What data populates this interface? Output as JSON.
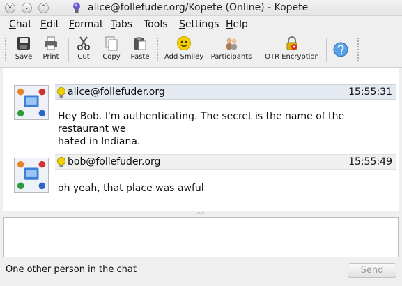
{
  "window": {
    "title": "alice@follefuder.org/Kopete (Online) - Kopete",
    "controls": [
      "close-icon",
      "minimize-icon",
      "maximize-icon"
    ]
  },
  "menu": [
    {
      "first": "C",
      "rest": "hat"
    },
    {
      "first": "E",
      "rest": "dit"
    },
    {
      "first": "F",
      "rest": "ormat"
    },
    {
      "first": "T",
      "rest": "abs"
    },
    {
      "first": "To",
      "rest": "ols",
      "ul_index": 1
    },
    {
      "first": "S",
      "rest": "ettings"
    },
    {
      "first": "H",
      "rest": "elp"
    }
  ],
  "toolbar": {
    "save": "Save",
    "print": "Print",
    "cut": "Cut",
    "copy": "Copy",
    "paste": "Paste",
    "add_smiley": "Add Smiley",
    "participants": "Participants",
    "otr": "OTR Encryption"
  },
  "messages": [
    {
      "sender": "alice@follefuder.org",
      "time": "15:55:31",
      "line1": "Hey Bob. I'm authenticating. The secret is the name of the restaurant we",
      "line2": "hated in Indiana."
    },
    {
      "sender": "bob@follefuder.org",
      "time": "15:55:49",
      "line1": "oh yeah, that place was awful"
    }
  ],
  "input": {
    "value": ""
  },
  "status": {
    "text": "One other person in the chat"
  },
  "send_button": {
    "label": "Send"
  },
  "colors": {
    "header_highlight": "#e5e9f1",
    "window_bg": "#efefef"
  }
}
